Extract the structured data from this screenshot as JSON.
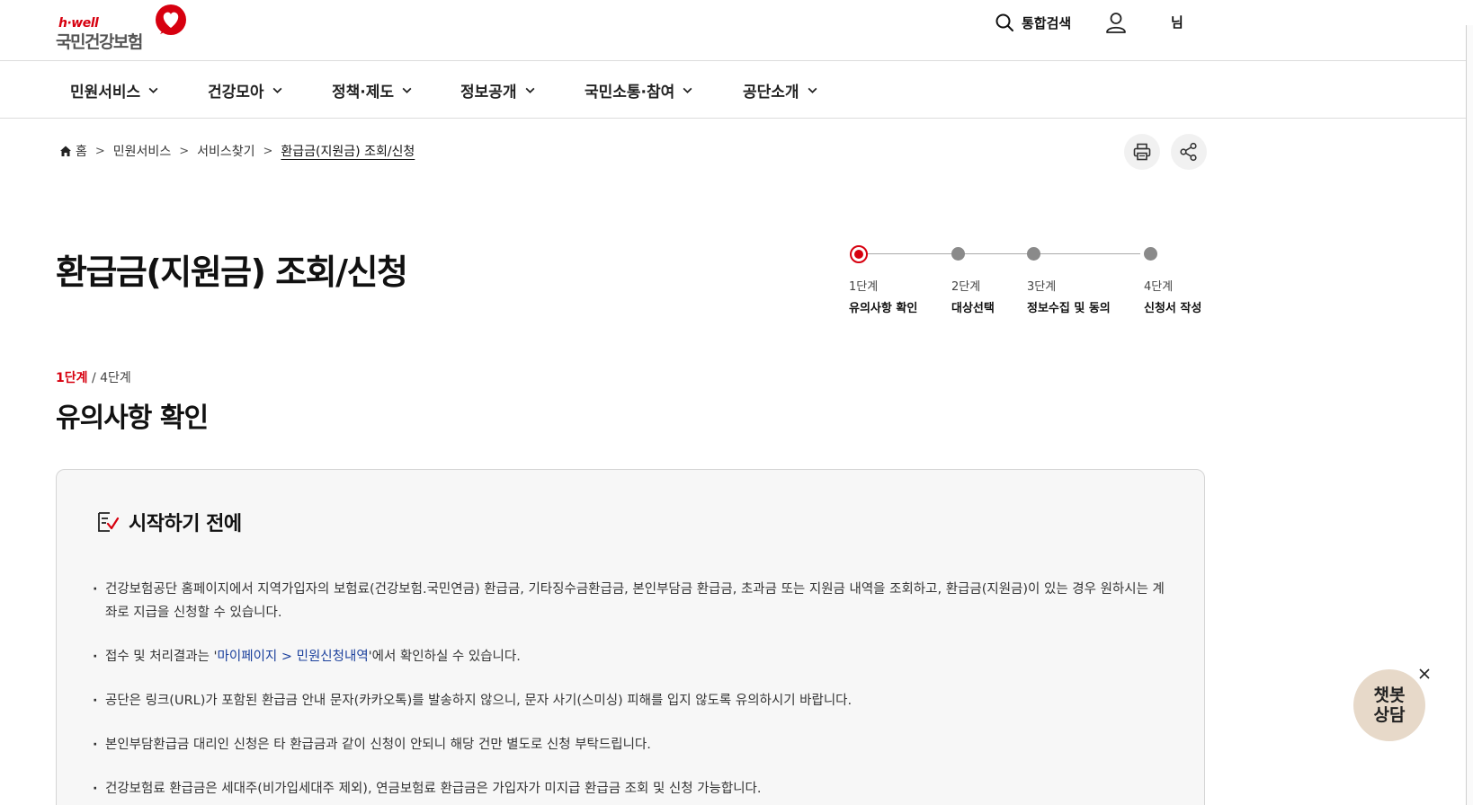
{
  "header": {
    "logo_sub": "h·well",
    "logo_main": "국민건강보험",
    "search_label": "통합검색",
    "user_suffix": "님"
  },
  "nav": {
    "items": [
      "민원서비스",
      "건강모아",
      "정책·제도",
      "정보공개",
      "국민소통·참여",
      "공단소개"
    ]
  },
  "breadcrumb": {
    "home": "홈",
    "items": [
      "민원서비스",
      "서비스찾기",
      "환급금(지원금) 조회/신청"
    ]
  },
  "page": {
    "title": "환급금(지원금) 조회/신청"
  },
  "stepper": {
    "steps": [
      {
        "num": "1단계",
        "name": "유의사항 확인",
        "active": true
      },
      {
        "num": "2단계",
        "name": "대상선택",
        "active": false
      },
      {
        "num": "3단계",
        "name": "정보수집 및 동의",
        "active": false
      },
      {
        "num": "4단계",
        "name": "신청서 작성",
        "active": false
      }
    ]
  },
  "step_indicator": {
    "current": "1단계",
    "total": "/ 4단계",
    "heading": "유의사항 확인"
  },
  "notice": {
    "title": "시작하기 전에",
    "items": [
      "건강보험공단 홈페이지에서 지역가입자의 보험료(건강보험.국민연금) 환급금, 기타징수금환급금, 본인부담금 환급금, 초과금 또는 지원금 내역을 조회하고, 환급금(지원금)이 있는 경우 원하시는 계좌로 지급을 신청할 수 있습니다.",
      {
        "pre": "접수 및 처리결과는 '",
        "link": "마이페이지 > 민원신청내역",
        "post": "'에서 확인하실 수 있습니다."
      },
      "공단은 링크(URL)가 포함된 환급금 안내 문자(카카오톡)를 발송하지 않으니, 문자 사기(스미싱) 피해를 입지 않도록 유의하시기 바랍니다.",
      "본인부담환급금 대리인 신청은 타 환급금과 같이 신청이 안되니 해당 건만 별도로 신청 부탁드립니다.",
      "건강보험료 환급금은 세대주(비가입세대주 제외), 연금보험료 환급금은 가입자가 미지급 환급금 조회 및 신청 가능합니다."
    ]
  },
  "chatbot": {
    "label_line1": "챗봇",
    "label_line2": "상담"
  },
  "colors": {
    "accent": "#d7000f",
    "link": "#1a3f9c",
    "chatbot_bg": "#e7d9c9"
  }
}
